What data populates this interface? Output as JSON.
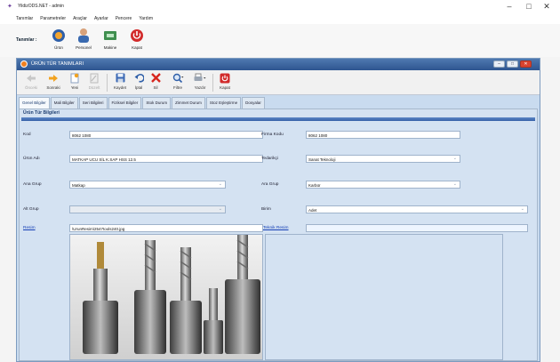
{
  "app": {
    "title": "YildizODS.NET - admin",
    "controls": {
      "minimize": "–",
      "maximize": "□",
      "close": "✕"
    }
  },
  "menu": [
    "Tanımlar",
    "Parametreler",
    "Araçlar",
    "Ayarlar",
    "Pencere",
    "Yardım"
  ],
  "main_toolbar": {
    "label": "Tanımlar :",
    "buttons": [
      {
        "label": "Ürün",
        "icon": "product-icon"
      },
      {
        "label": "Personel",
        "icon": "person-icon"
      },
      {
        "label": "Makine",
        "icon": "machine-icon"
      },
      {
        "label": "Kapat",
        "icon": "power-icon"
      }
    ]
  },
  "window": {
    "title": "ÜRÜN TÜR TANIMLARI",
    "controls": {
      "minimize": "–",
      "maximize": "□",
      "close": "✕"
    }
  },
  "toolbar": [
    {
      "label": "Önceki",
      "icon": "arrow-left-icon",
      "enabled": false
    },
    {
      "label": "Sonraki",
      "icon": "arrow-right-icon",
      "enabled": true
    },
    {
      "label": "Yeni",
      "icon": "new-icon",
      "enabled": true
    },
    {
      "label": "Düzelt",
      "icon": "edit-icon",
      "enabled": false
    },
    {
      "label": "Kaydet",
      "icon": "save-icon",
      "enabled": true
    },
    {
      "label": "İptal",
      "icon": "undo-icon",
      "enabled": true
    },
    {
      "label": "Sil",
      "icon": "delete-icon",
      "enabled": true
    },
    {
      "label": "Filtre",
      "icon": "search-icon",
      "enabled": true
    },
    {
      "label": "Yazdır",
      "icon": "printer-icon",
      "enabled": true
    },
    {
      "label": "Kapat",
      "icon": "power-icon",
      "enabled": true
    }
  ],
  "tabs": [
    {
      "label": "Genel Bilgiler",
      "active": true
    },
    {
      "label": "Mali Bilgiler",
      "active": false
    },
    {
      "label": "Seri Bilgileri",
      "active": false
    },
    {
      "label": "Fiziksel Bilgiler",
      "active": false
    },
    {
      "label": "Stok Durum",
      "active": false
    },
    {
      "label": "Zimmet Durum",
      "active": false
    },
    {
      "label": "Stoz Eşleştirme",
      "active": false
    },
    {
      "label": "Dosyalar",
      "active": false
    }
  ],
  "form": {
    "header": "Ürün Tür Bilgileri",
    "kod": {
      "label": "Kod",
      "value": "8062 1080"
    },
    "firma_kodu": {
      "label": "Firma Kodu",
      "value": "8062 1080"
    },
    "urun_adi": {
      "label": "Ürün Adı",
      "value": "MATKAP UCU SİL K.SAP HSS 12.5"
    },
    "tedarikci": {
      "label": "Tedarikçi",
      "value": "Sanat Teknoloji"
    },
    "ana_grup_left": {
      "label": "Ana Grup",
      "value": "Matkap"
    },
    "ara_grup": {
      "label": "Ara Grup",
      "value": "Karbür"
    },
    "alt_grup": {
      "label": "Alt Grup",
      "value": ""
    },
    "birim": {
      "label": "Birim",
      "value": "Adet"
    },
    "resim": {
      "label": "Resim",
      "value": "\\UrunResim\\2547tools240.jpg"
    },
    "teknik_resim": {
      "label": "Teknik Resim",
      "value": ""
    }
  }
}
